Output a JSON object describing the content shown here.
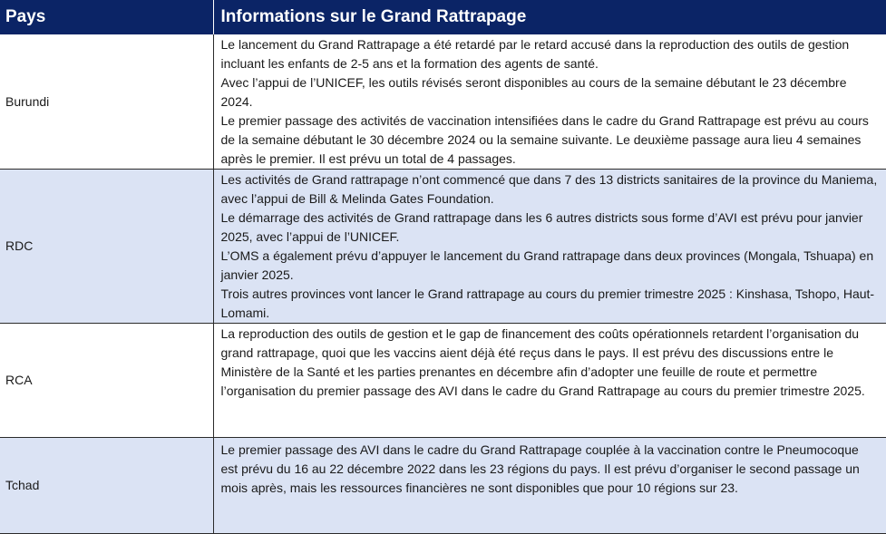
{
  "header": {
    "country": "Pays",
    "info": "Informations sur le Grand Rattrapage"
  },
  "rows": [
    {
      "country": "Burundi",
      "paragraphs": [
        "Le lancement du Grand Rattrapage a été retardé par le retard accusé dans la reproduction des outils de gestion incluant les enfants de 2-5 ans et la formation des agents de santé.",
        "Avec l’appui de l’UNICEF, les outils révisés seront disponibles au cours de la semaine débutant le 23 décembre 2024.",
        "Le premier passage des activités de vaccination intensifiées dans le cadre du Grand Rattrapage est prévu au cours de la semaine débutant le 30 décembre 2024 ou la semaine suivante. Le deuxième passage aura lieu 4 semaines après le premier. Il est prévu un total de 4 passages."
      ]
    },
    {
      "country": "RDC",
      "paragraphs": [
        "Les activités de Grand rattrapage n’ont commencé que dans 7 des 13 districts sanitaires de la province du Maniema, avec l’appui de Bill & Melinda Gates Foundation.",
        "Le démarrage des activités de Grand rattrapage dans les 6 autres districts sous forme d’AVI est prévu pour janvier 2025, avec l’appui de l’UNICEF.",
        "L’OMS a également prévu d’appuyer le lancement du Grand rattrapage dans deux provinces (Mongala, Tshuapa) en janvier 2025.",
        "Trois autres provinces vont lancer le Grand rattrapage au cours du premier trimestre 2025 : Kinshasa, Tshopo, Haut-Lomami."
      ]
    },
    {
      "country": "RCA",
      "paragraphs": [
        "La reproduction des outils de gestion et le gap de financement des coûts opérationnels retardent l’organisation du grand rattrapage, quoi que les vaccins aient déjà été reçus dans le pays. Il est prévu des discussions entre le Ministère de la Santé et les parties prenantes en décembre afin d’adopter une feuille de route et permettre l’organisation du premier passage des AVI dans le cadre du Grand Rattrapage au cours du premier trimestre 2025."
      ]
    },
    {
      "country": "Tchad",
      "paragraphs": [
        "Le premier passage des AVI dans le cadre du Grand Rattrapage couplée à la vaccination contre le Pneumocoque est prévu du 16 au 22 décembre 2022 dans les 23 régions du pays. Il est prévu d’organiser le second passage un mois après, mais les ressources financières ne sont disponibles que pour 10 régions sur 23."
      ]
    }
  ],
  "colors": {
    "header_bg": "#0b2466",
    "header_text": "#ffffff",
    "band_blue": "#dbe3f4",
    "band_white": "#ffffff"
  }
}
